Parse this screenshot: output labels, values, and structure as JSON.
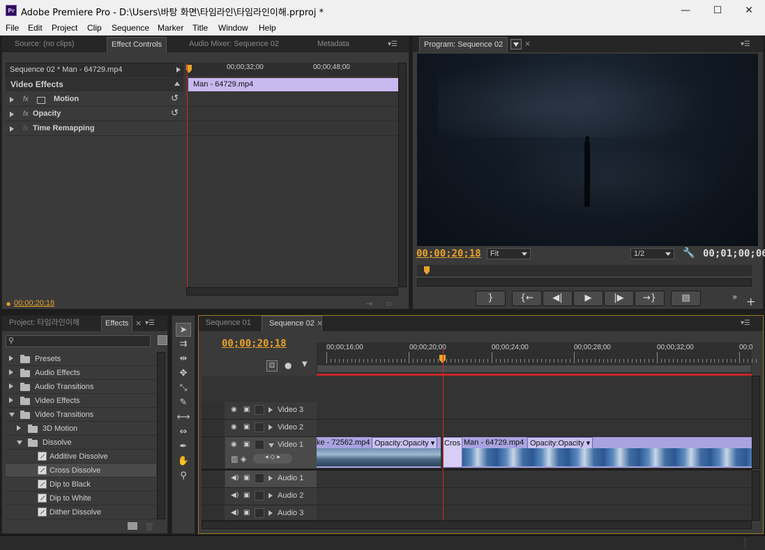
{
  "window": {
    "title": "Adobe Premiere Pro - D:\\Users\\바탕 화면\\타임라인\\타임라인이해.prproj *",
    "app_icon": "Pr",
    "min_label": "—",
    "max_label": "☐",
    "close_label": "✕"
  },
  "menu": [
    "File",
    "Edit",
    "Project",
    "Clip",
    "Sequence",
    "Marker",
    "Title",
    "Window",
    "Help"
  ],
  "source_panel": {
    "tabs": [
      "Source: (no clips)",
      "Effect Controls",
      "Audio Mixer: Sequence 02",
      "Metadata"
    ],
    "sequence_label": "Sequence 02 * Man - 64729.mp4",
    "time_ticks": [
      "00;00;32;00",
      "00;00;48;00"
    ],
    "clip_name": "Man - 64729.mp4",
    "section": "Video Effects",
    "effects": [
      "Motion",
      "Opacity",
      "Time Remapping"
    ],
    "fx_label": "fx",
    "timecode": "00;00;20;18"
  },
  "program_panel": {
    "tab": "Program: Sequence 02",
    "timecode_current": "00;00;20;18",
    "fit": "Fit",
    "resolution": "1/2",
    "timecode_duration": "00;01;00;06"
  },
  "project_panel": {
    "tabs": [
      "Project: 타임라인이해",
      "Effects"
    ],
    "tree": [
      {
        "label": "Presets",
        "level": 0,
        "kind": "folder",
        "state": "collapsed"
      },
      {
        "label": "Audio Effects",
        "level": 0,
        "kind": "folder",
        "state": "collapsed"
      },
      {
        "label": "Audio Transitions",
        "level": 0,
        "kind": "folder",
        "state": "collapsed"
      },
      {
        "label": "Video Effects",
        "level": 0,
        "kind": "folder",
        "state": "collapsed"
      },
      {
        "label": "Video Transitions",
        "level": 0,
        "kind": "folder",
        "state": "expanded"
      },
      {
        "label": "3D Motion",
        "level": 1,
        "kind": "folder",
        "state": "collapsed"
      },
      {
        "label": "Dissolve",
        "level": 1,
        "kind": "folder",
        "state": "expanded"
      },
      {
        "label": "Additive Dissolve",
        "level": 2,
        "kind": "item"
      },
      {
        "label": "Cross Dissolve",
        "level": 2,
        "kind": "item",
        "selected": true
      },
      {
        "label": "Dip to Black",
        "level": 2,
        "kind": "item"
      },
      {
        "label": "Dip to White",
        "level": 2,
        "kind": "item"
      },
      {
        "label": "Dither Dissolve",
        "level": 2,
        "kind": "item"
      }
    ]
  },
  "timeline": {
    "tabs": [
      "Sequence 01",
      "Sequence 02"
    ],
    "timecode": "00;00;20;18",
    "ticks": [
      "00;00;16;00",
      "00;00;20;00",
      "00;00;24;00",
      "00;00;28;00",
      "00;00;32;00",
      "00;0"
    ],
    "tracks": [
      "Video 3",
      "Video 2",
      "Video 1",
      "Audio 1",
      "Audio 2",
      "Audio 3"
    ],
    "clips": [
      {
        "name": "ke - 72562.mp4",
        "fx": "Opacity:Opacity"
      },
      {
        "name": "Cros",
        "fx": ""
      },
      {
        "name": "Man - 64729.mp4",
        "fx": "Opacity:Opacity"
      }
    ]
  },
  "colors": {
    "accent": "#e8a32a",
    "clip_video": "#a9a3e0",
    "clip_effect": "#c9b8f0",
    "playhead": "#d12a2a"
  }
}
